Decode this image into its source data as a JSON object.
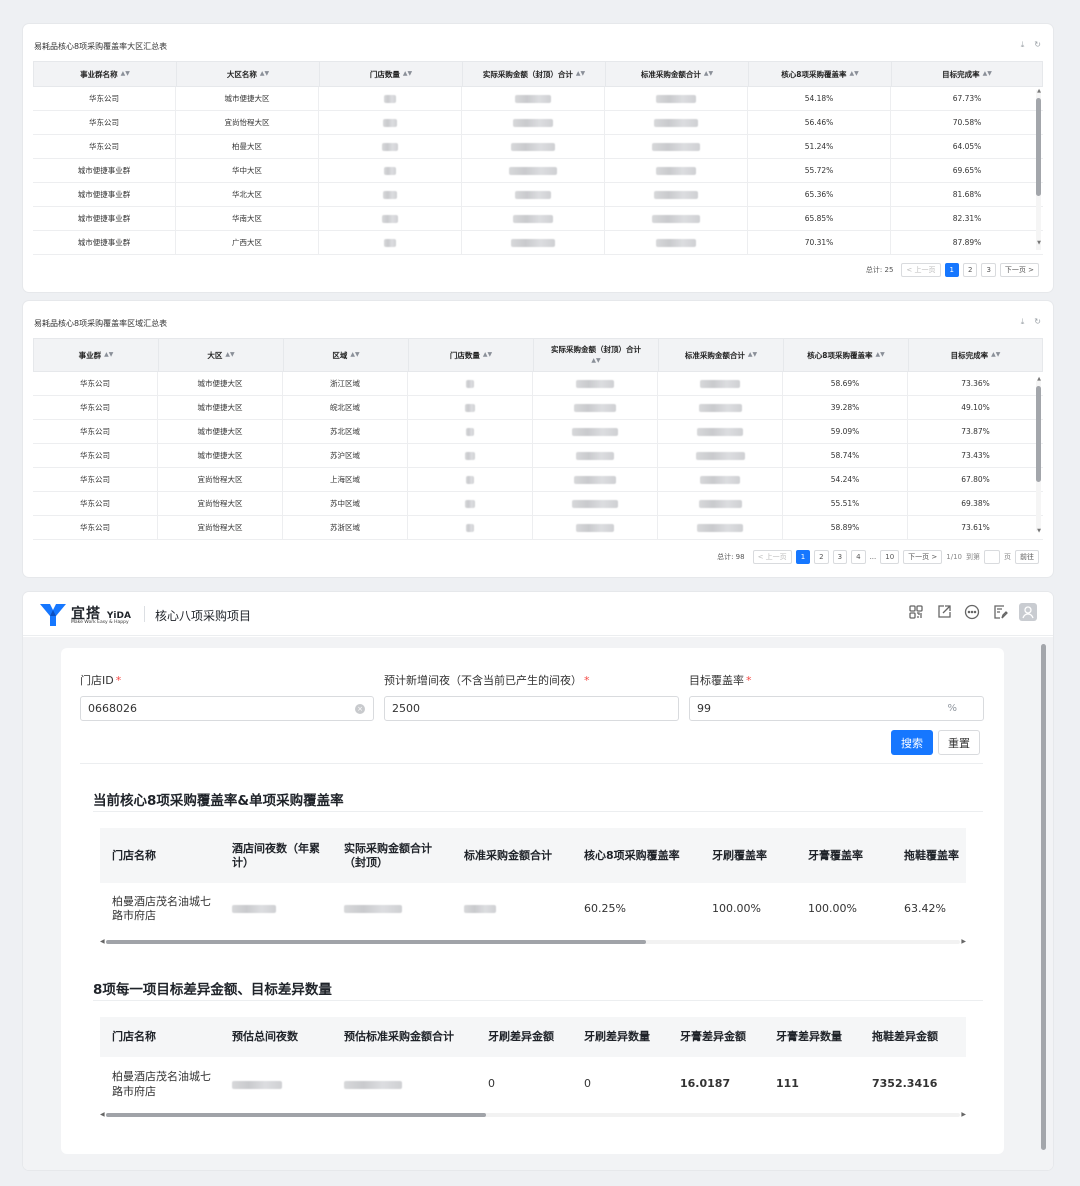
{
  "region_table": {
    "title": "易耗品核心8项采购覆盖率大区汇总表",
    "columns": [
      "事业群名称",
      "大区名称",
      "门店数量",
      "实际采购金额（封顶）合计",
      "标准采购金额合计",
      "核心8项采购覆盖率",
      "目标完成率"
    ],
    "rows": [
      {
        "group": "华东公司",
        "region": "城市便捷大区",
        "coverage": "54.18%",
        "completion": "67.73%"
      },
      {
        "group": "华东公司",
        "region": "宜尚怡程大区",
        "coverage": "56.46%",
        "completion": "70.58%"
      },
      {
        "group": "华东公司",
        "region": "柏曼大区",
        "coverage": "51.24%",
        "completion": "64.05%"
      },
      {
        "group": "城市便捷事业群",
        "region": "华中大区",
        "coverage": "55.72%",
        "completion": "69.65%"
      },
      {
        "group": "城市便捷事业群",
        "region": "华北大区",
        "coverage": "65.36%",
        "completion": "81.68%"
      },
      {
        "group": "城市便捷事业群",
        "region": "华南大区",
        "coverage": "65.85%",
        "completion": "82.31%"
      },
      {
        "group": "城市便捷事业群",
        "region": "广西大区",
        "coverage": "70.31%",
        "completion": "87.89%"
      }
    ],
    "pager": {
      "total": "总计: 25",
      "prev": "< 上一页",
      "pages": [
        "1",
        "2",
        "3"
      ],
      "next": "下一页 >"
    }
  },
  "area_table": {
    "title": "易耗品核心8项采购覆盖率区域汇总表",
    "columns": [
      "事业群",
      "大区",
      "区域",
      "门店数量",
      "实际采购金额（封顶）合计",
      "标准采购金额合计",
      "核心8项采购覆盖率",
      "目标完成率"
    ],
    "rows": [
      {
        "group": "华东公司",
        "region": "城市便捷大区",
        "area": "浙江区域",
        "coverage": "58.69%",
        "completion": "73.36%"
      },
      {
        "group": "华东公司",
        "region": "城市便捷大区",
        "area": "皖北区域",
        "coverage": "39.28%",
        "completion": "49.10%"
      },
      {
        "group": "华东公司",
        "region": "城市便捷大区",
        "area": "苏北区域",
        "coverage": "59.09%",
        "completion": "73.87%"
      },
      {
        "group": "华东公司",
        "region": "城市便捷大区",
        "area": "苏沪区域",
        "coverage": "58.74%",
        "completion": "73.43%"
      },
      {
        "group": "华东公司",
        "region": "宜尚怡程大区",
        "area": "上海区域",
        "coverage": "54.24%",
        "completion": "67.80%"
      },
      {
        "group": "华东公司",
        "region": "宜尚怡程大区",
        "area": "苏中区域",
        "coverage": "55.51%",
        "completion": "69.38%"
      },
      {
        "group": "华东公司",
        "region": "宜尚怡程大区",
        "area": "苏浙区域",
        "coverage": "58.89%",
        "completion": "73.61%"
      }
    ],
    "pager": {
      "total": "总计: 98",
      "prev": "< 上一页",
      "pages": [
        "1",
        "2",
        "3",
        "4",
        "...",
        "10"
      ],
      "next": "下一页 >",
      "page_info": "1/10",
      "goto_label": "到第",
      "page_unit": "页",
      "go": "前往"
    }
  },
  "app": {
    "logo_text": "宜搭",
    "logo_en": "YiDA",
    "logo_slogan": "Make Work Easy & Happy",
    "title": "核心八项采购项目",
    "form": {
      "store_id_label": "门店ID",
      "store_id_value": "0668026",
      "nights_label": "预计新增间夜（不含当前已产生的间夜）",
      "nights_value": "2500",
      "target_label": "目标覆盖率",
      "target_value": "99",
      "target_suffix": "%",
      "search_btn": "搜索",
      "reset_btn": "重置"
    },
    "section1": {
      "title": "当前核心8项采购覆盖率&单项采购覆盖率",
      "columns": [
        "门店名称",
        "酒店间夜数（年累计）",
        "实际采购金额合计（封顶）",
        "标准采购金额合计",
        "核心8项采购覆盖率",
        "牙刷覆盖率",
        "牙膏覆盖率",
        "拖鞋覆盖率"
      ],
      "row": {
        "store": "柏曼酒店茂名油城七路市府店",
        "coverage": "60.25%",
        "toothbrush": "100.00%",
        "toothpaste": "100.00%",
        "slipper": "63.42%"
      }
    },
    "section2": {
      "title": "8项每一项目标差异金额、目标差异数量",
      "columns": [
        "门店名称",
        "预估总间夜数",
        "预估标准采购金额合计",
        "牙刷差异金额",
        "牙刷差异数量",
        "牙膏差异金额",
        "牙膏差异数量",
        "拖鞋差异金额"
      ],
      "row": {
        "store": "柏曼酒店茂名油城七路市府店",
        "brush_amt": "0",
        "brush_qty": "0",
        "paste_amt": "16.0187",
        "paste_qty": "111",
        "slipper_amt": "7352.3416"
      }
    },
    "accent_color": "#1677ff",
    "alert_color": "#e60012"
  }
}
